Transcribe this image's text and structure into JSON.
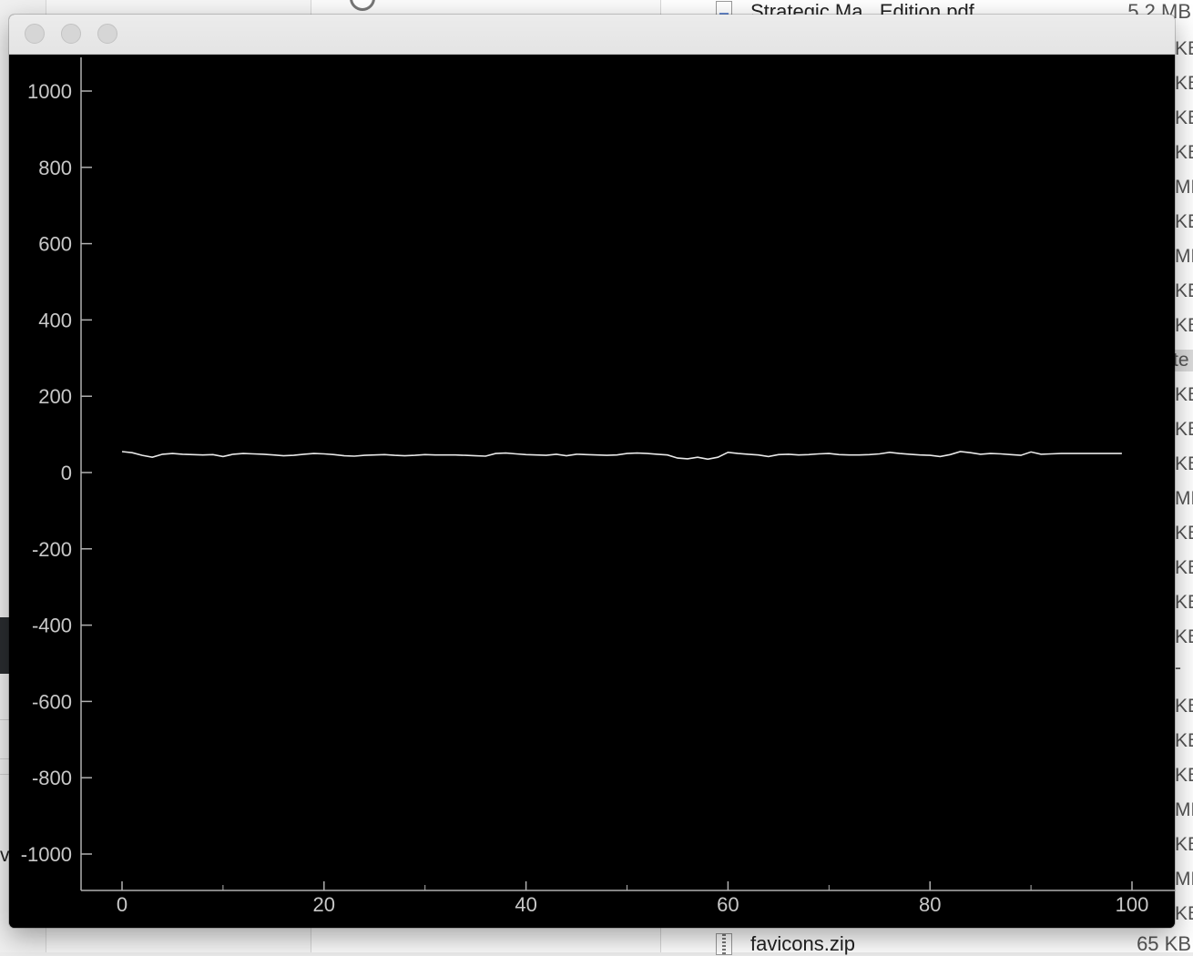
{
  "background_window": {
    "files": [
      {
        "name": "Strategic Ma...Edition.pdf",
        "size": "5.2 MB"
      },
      {
        "name": "favicons.zip",
        "size": "65 KB"
      }
    ],
    "size_column_fragments": [
      "KB",
      "KB",
      "KB",
      "KB",
      "MB",
      "KB",
      "MB",
      "KB",
      "KB",
      "te",
      "KB",
      "KB",
      "KB",
      "MB",
      "KB",
      "KB",
      "KB",
      "KB",
      "-",
      "KB",
      "KB",
      "KB",
      "MB",
      "KB",
      "MB",
      "KB"
    ],
    "left_fragment": "v"
  },
  "plot_window": {
    "title": "",
    "colors": {
      "background": "#000000",
      "line": "#e8e8e8",
      "axis": "#b0b0b0"
    }
  },
  "chart_data": {
    "type": "line",
    "title": "",
    "xlabel": "",
    "ylabel": "",
    "xlim": [
      -4,
      102
    ],
    "ylim": [
      -1090,
      1090
    ],
    "x_ticks": [
      0,
      20,
      40,
      60,
      80,
      100
    ],
    "y_ticks": [
      1000,
      800,
      600,
      400,
      200,
      0,
      -200,
      -400,
      -600,
      -800,
      -1000
    ],
    "series": [
      {
        "x": [
          0,
          1,
          2,
          3,
          4,
          5,
          6,
          7,
          8,
          9,
          10,
          11,
          12,
          13,
          14,
          15,
          16,
          17,
          18,
          19,
          20,
          21,
          22,
          23,
          24,
          25,
          26,
          27,
          28,
          29,
          30,
          31,
          32,
          33,
          34,
          35,
          36,
          37,
          38,
          39,
          40,
          41,
          42,
          43,
          44,
          45,
          46,
          47,
          48,
          49,
          50,
          51,
          52,
          53,
          54,
          55,
          56,
          57,
          58,
          59,
          60,
          61,
          62,
          63,
          64,
          65,
          66,
          67,
          68,
          69,
          70,
          71,
          72,
          73,
          74,
          75,
          76,
          77,
          78,
          79,
          80,
          81,
          82,
          83,
          84,
          85,
          86,
          87,
          88,
          89,
          90,
          91,
          92,
          93,
          94,
          95,
          96,
          97,
          98,
          99
        ],
        "values": [
          55,
          52,
          45,
          40,
          48,
          50,
          48,
          47,
          46,
          47,
          42,
          48,
          50,
          49,
          48,
          46,
          44,
          45,
          48,
          50,
          49,
          47,
          44,
          43,
          45,
          46,
          47,
          45,
          44,
          45,
          47,
          46,
          46,
          46,
          45,
          44,
          43,
          50,
          51,
          49,
          47,
          46,
          45,
          48,
          44,
          48,
          47,
          46,
          45,
          46,
          50,
          51,
          50,
          48,
          46,
          38,
          36,
          40,
          35,
          40,
          53,
          50,
          48,
          46,
          42,
          47,
          48,
          46,
          47,
          49,
          50,
          47,
          46,
          46,
          47,
          49,
          53,
          50,
          48,
          46,
          45,
          42,
          47,
          55,
          52,
          48,
          50,
          49,
          47,
          45,
          54,
          48,
          49,
          50,
          50,
          50,
          50,
          50,
          50,
          50
        ]
      }
    ]
  }
}
